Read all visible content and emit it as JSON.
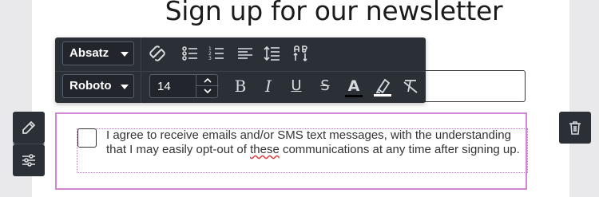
{
  "page": {
    "title": "Sign up for our newsletter"
  },
  "toolbar": {
    "paragraph_select": "Absatz",
    "font_select": "Roboto",
    "font_size": "14",
    "buttons": {
      "link": "link-icon",
      "bulleted_list": "bulleted-list-icon",
      "numbered_list": "numbered-list-icon",
      "align": "align-left-icon",
      "line_height": "line-height-icon",
      "text_direction": "text-direction-icon",
      "bold": "B",
      "italic": "I",
      "underline": "U",
      "strikethrough": "S",
      "text_color": "A",
      "highlight": "highlighter-icon",
      "clear_format": "clear-format-icon"
    },
    "colors": {
      "background": "#2b3037",
      "text_color_underline": "#000000"
    }
  },
  "consent": {
    "text_before": "I agree to receive emails and/or SMS text messages, with the understanding that I may easily opt-out of ",
    "misspelled": "these",
    "text_after": " communications at any time after signing up."
  },
  "colors": {
    "selection_border": "#d486d6",
    "spell_underline": "#e03a3a"
  }
}
